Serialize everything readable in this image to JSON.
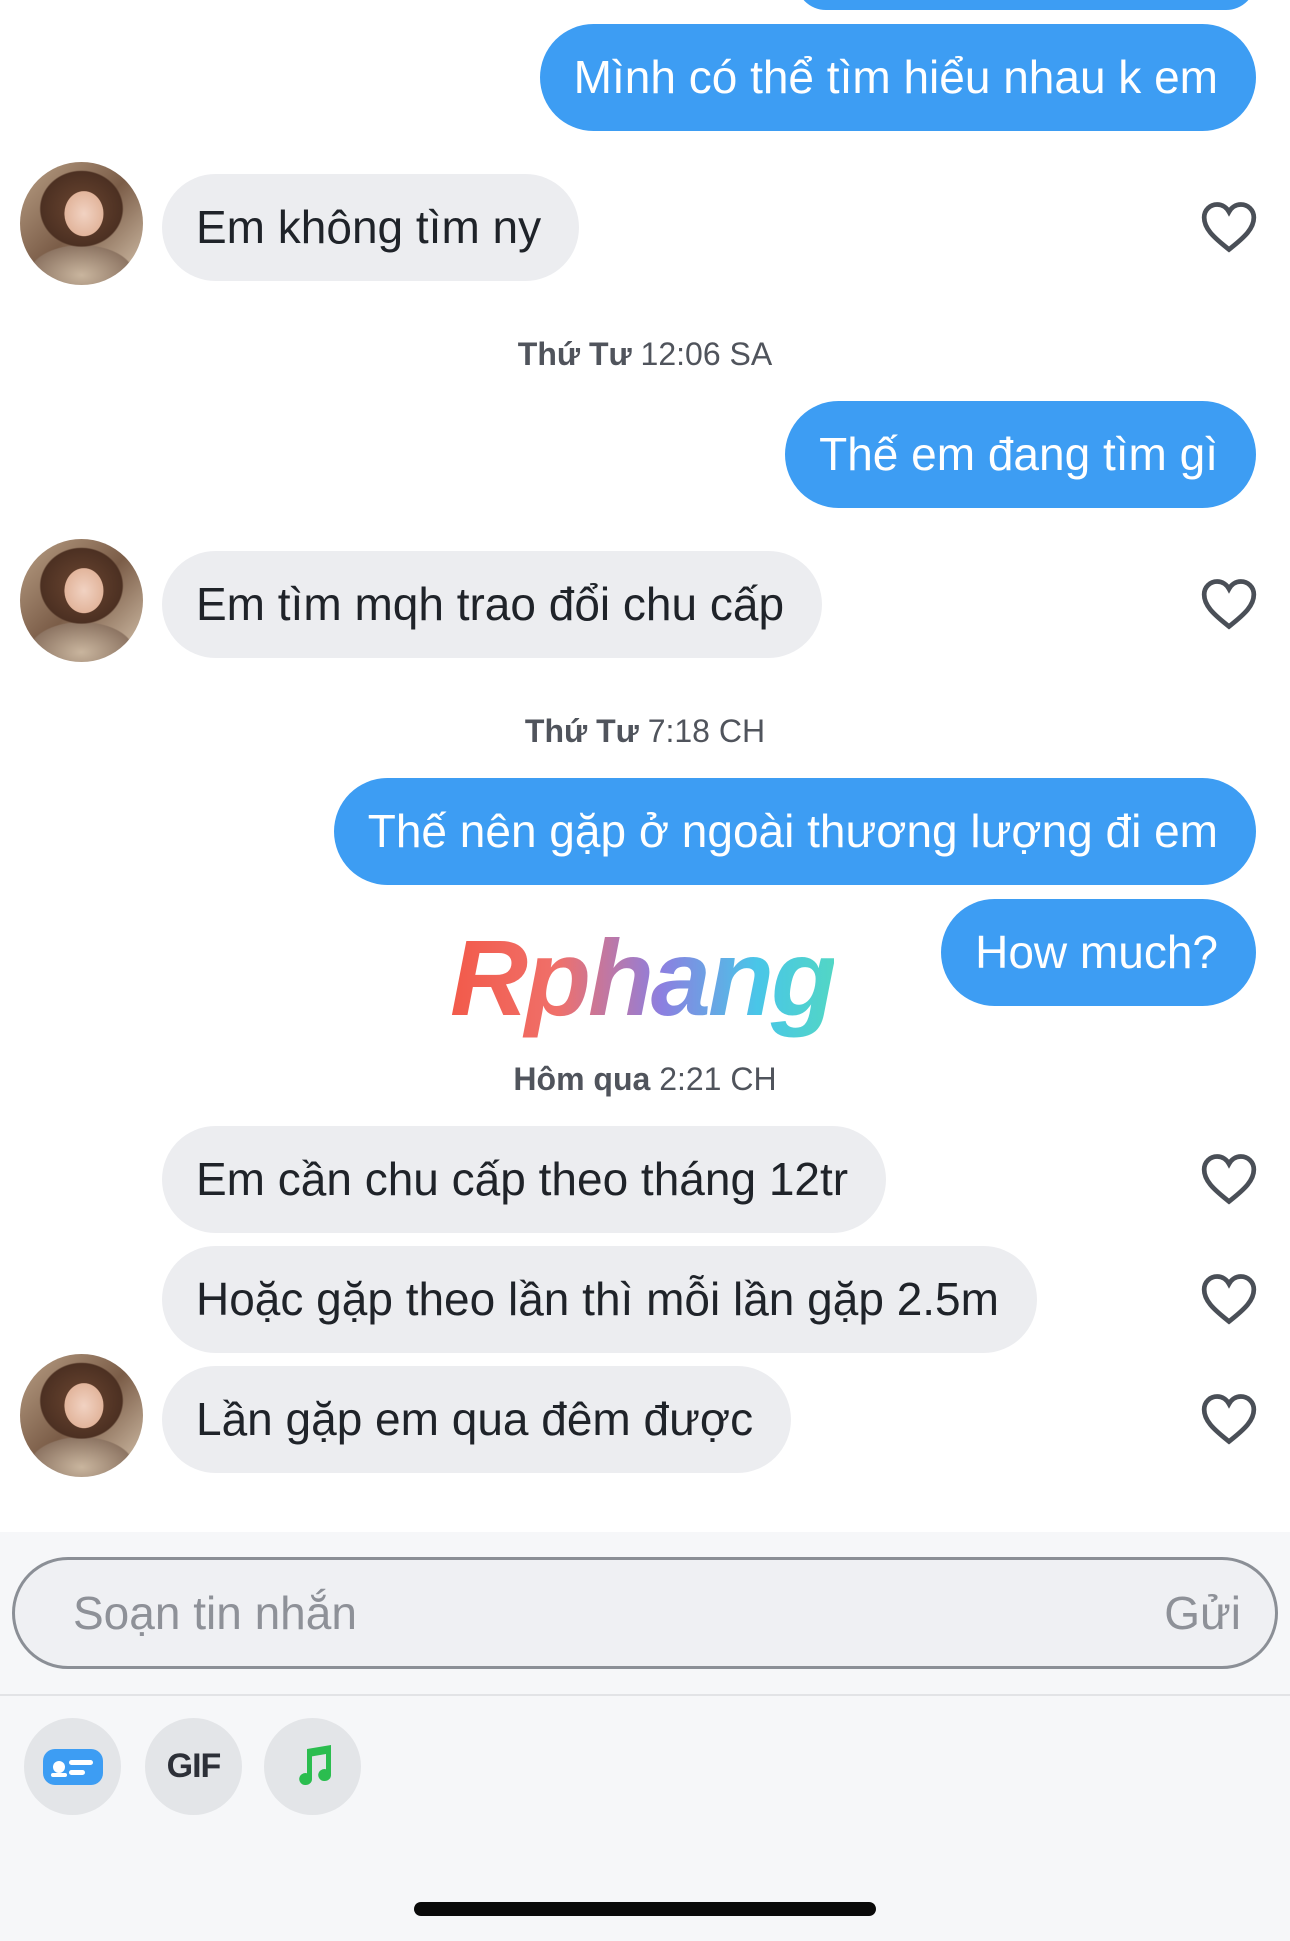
{
  "colors": {
    "sent_bubble": "#3d9df3",
    "received_bubble": "#ecedf0",
    "background": "#ffffff"
  },
  "conversation": {
    "messages": [
      {
        "side": "sent",
        "text": "Mình có thể tìm hiểu nhau k em"
      },
      {
        "side": "received",
        "text": "Em không tìm ny",
        "liked": false
      },
      {
        "type": "timestamp",
        "day": "Thứ Tư",
        "time": "12:06 SA"
      },
      {
        "side": "sent",
        "text": "Thế em đang tìm gì"
      },
      {
        "side": "received",
        "text": "Em tìm mqh trao đổi chu cấp",
        "liked": false
      },
      {
        "type": "timestamp",
        "day": "Thứ Tư",
        "time": "7:18 CH"
      },
      {
        "side": "sent",
        "text": "Thế nên gặp ở ngoài thương lượng đi em"
      },
      {
        "side": "sent",
        "text": "How much?"
      },
      {
        "type": "timestamp",
        "day": "Hôm qua",
        "time": "2:21 CH"
      },
      {
        "side": "received",
        "text": "Em cần chu cấp theo tháng 12tr",
        "liked": false
      },
      {
        "side": "received",
        "text": "Hoặc gặp theo lần thì mỗi lần gặp 2.5m",
        "liked": false
      },
      {
        "side": "received",
        "text": "Lần gặp em qua đêm được",
        "liked": false
      }
    ]
  },
  "watermark": {
    "text": "Rphang"
  },
  "composer": {
    "placeholder": "Soạn tin nhắn",
    "send_label": "Gửi"
  },
  "toolbar": {
    "items": [
      {
        "name": "sticker-card",
        "icon": "card-icon",
        "color": "#3d9df3"
      },
      {
        "name": "gif",
        "label": "GIF"
      },
      {
        "name": "music",
        "icon": "music-note-icon",
        "color": "#2bbd4f"
      }
    ]
  }
}
